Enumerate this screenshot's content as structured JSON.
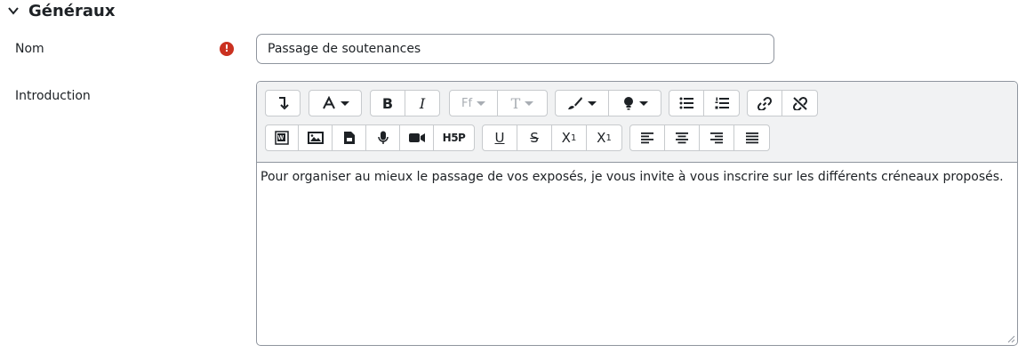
{
  "section": {
    "title": "Généraux"
  },
  "name_field": {
    "label": "Nom",
    "required_icon": "!",
    "value": "Passage de soutenances"
  },
  "intro_field": {
    "label": "Introduction",
    "content": "Pour organiser au mieux le passage de vos exposés, je vous invite à vous inscrire sur les différents créneaux proposés."
  },
  "toolbar": {
    "bold": "B",
    "italic": "I",
    "font_family": "Ff",
    "font_size": "T",
    "h5p": "H5P",
    "underline": "U",
    "strikethrough": "S",
    "subscript": "X",
    "subscript_digit": "1",
    "superscript": "X",
    "superscript_digit": "1"
  },
  "colors": {
    "required": "#ca3120",
    "toolbar_bg": "#f1f2f3",
    "border": "#8f959e"
  }
}
